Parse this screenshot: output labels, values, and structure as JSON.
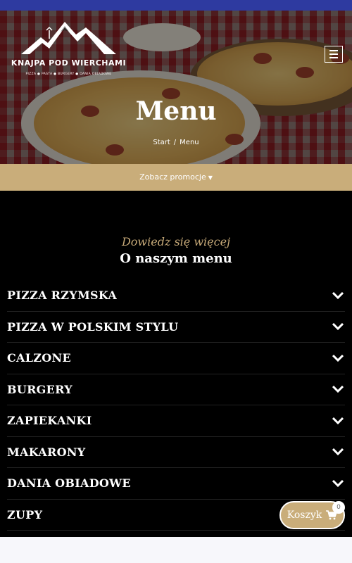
{
  "brand": {
    "name": "KNAJPA POD WIERCHAMI",
    "tagline": "PIZZA  ●  PASTA  ●  BURGERY  ●  DANIA OBIADOWE"
  },
  "hero": {
    "title": "Menu",
    "breadcrumb": {
      "home": "Start",
      "separator": "/",
      "current": "Menu"
    }
  },
  "promo": {
    "label": "Zobacz promocje"
  },
  "section": {
    "subtitle": "Dowiedz się więcej",
    "title": "O naszym menu"
  },
  "categories": [
    {
      "label": "PIZZA RZYMSKA"
    },
    {
      "label": "PIZZA W POLSKIM STYLU"
    },
    {
      "label": "CALZONE"
    },
    {
      "label": "BURGERY"
    },
    {
      "label": "ZAPIEKANKI"
    },
    {
      "label": "MAKARONY"
    },
    {
      "label": "DANIA OBIADOWE"
    },
    {
      "label": "ZUPY"
    }
  ],
  "cart": {
    "label": "Koszyk",
    "count": "0",
    "icon": "cart-icon"
  },
  "colors": {
    "accent": "#c9ad7a",
    "topbar": "#2e3aa0",
    "dark_bg": "#000000"
  }
}
